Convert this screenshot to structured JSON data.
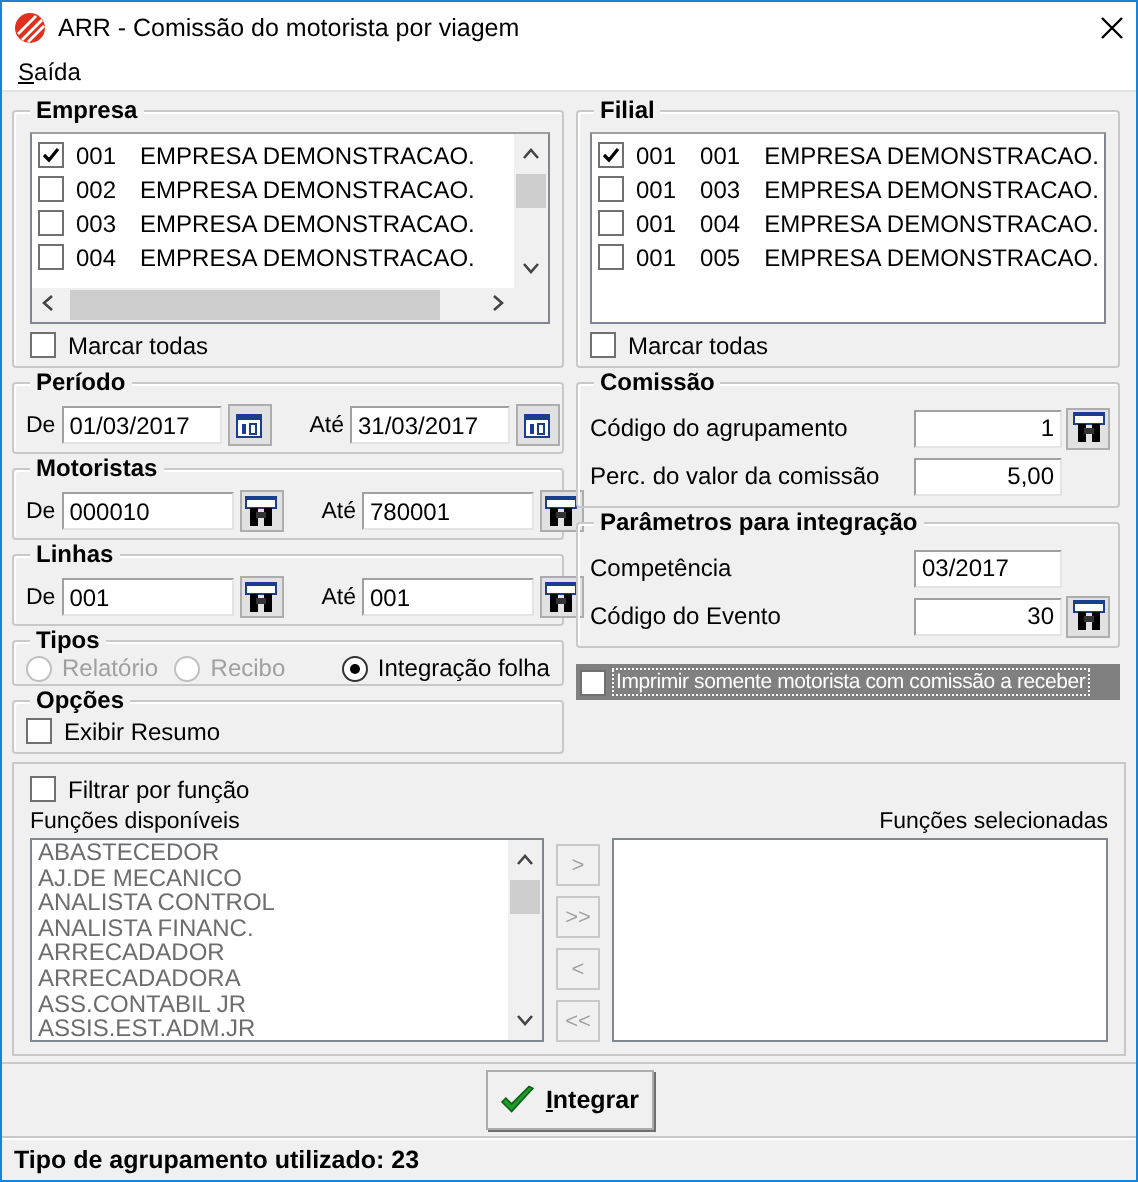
{
  "window": {
    "title": "ARR - Comissão do motorista por viagem"
  },
  "menu": [
    "Saída"
  ],
  "empresa": {
    "title": "Empresa",
    "items": [
      {
        "code": "001",
        "name": "EMPRESA DEMONSTRACAO.",
        "checked": true
      },
      {
        "code": "002",
        "name": "EMPRESA DEMONSTRACAO.",
        "checked": false
      },
      {
        "code": "003",
        "name": "EMPRESA DEMONSTRACAO.",
        "checked": false
      },
      {
        "code": "004",
        "name": "EMPRESA DEMONSTRACAO.",
        "checked": false
      }
    ],
    "select_all": {
      "label": "Marcar todas",
      "checked": false
    }
  },
  "filial": {
    "title": "Filial",
    "items": [
      {
        "company": "001",
        "code": "001",
        "name": "EMPRESA DEMONSTRACAO.",
        "checked": true
      },
      {
        "company": "001",
        "code": "003",
        "name": "EMPRESA DEMONSTRACAO.",
        "checked": false
      },
      {
        "company": "001",
        "code": "004",
        "name": "EMPRESA DEMONSTRACAO.",
        "checked": false
      },
      {
        "company": "001",
        "code": "005",
        "name": "EMPRESA DEMONSTRACAO.",
        "checked": false
      }
    ],
    "select_all": {
      "label": "Marcar todas",
      "checked": false
    }
  },
  "ranges": [
    {
      "title": "Período",
      "kind": "calendar",
      "from_label": "De",
      "from": "01/03/2017",
      "to_label": "Até",
      "to": "31/03/2017"
    },
    {
      "title": "Motoristas",
      "kind": "search",
      "from_label": "De",
      "from": "000010",
      "to_label": "Até",
      "to": "780001"
    },
    {
      "title": "Linhas",
      "kind": "search",
      "from_label": "De",
      "from": "001",
      "to_label": "Até",
      "to": "001"
    }
  ],
  "tipos": {
    "title": "Tipos",
    "options": [
      {
        "label": "Relatório",
        "selected": false,
        "disabled": true
      },
      {
        "label": "Recibo",
        "selected": false,
        "disabled": true
      },
      {
        "label": "Integração folha",
        "selected": true,
        "disabled": false
      }
    ]
  },
  "opcoes": {
    "title": "Opções",
    "items": [
      {
        "label": "Exibir Resumo",
        "checked": false
      }
    ]
  },
  "comissao": {
    "title": "Comissão",
    "fields": [
      {
        "label": "Código do agrupamento",
        "value": "1",
        "kind": "number",
        "lookup": true
      },
      {
        "label": "Perc. do valor da comissão",
        "value": "5,00",
        "kind": "number",
        "lookup": false
      }
    ]
  },
  "integracao": {
    "title": "Parâmetros para integração",
    "fields": [
      {
        "label": "Competência",
        "value": "03/2017",
        "kind": "text",
        "lookup": false
      },
      {
        "label": "Código do Evento",
        "value": "30",
        "kind": "number",
        "lookup": true
      }
    ]
  },
  "only_with_commission": {
    "label": "Imprimir somente motorista com comissão a receber",
    "checked": false
  },
  "funcoes": {
    "filter": {
      "label": "Filtrar por função",
      "checked": false
    },
    "available_label": "Funções disponíveis",
    "selected_label": "Funções selecionadas",
    "available": [
      "ABASTECEDOR",
      "AJ.DE MECANICO",
      "ANALISTA CONTROL",
      "ANALISTA FINANC.",
      "ARRECADADOR",
      "ARRECADADORA",
      "ASS.CONTABIL JR",
      "ASSIS.EST.ADM.JR"
    ],
    "move_buttons": [
      {
        "label": ">",
        "disabled": true
      },
      {
        "label": ">>",
        "disabled": true
      },
      {
        "label": "<",
        "disabled": true
      },
      {
        "label": "<<",
        "disabled": true
      }
    ]
  },
  "action_button": "Integrar",
  "status": "Tipo de agrupamento utilizado: 23"
}
